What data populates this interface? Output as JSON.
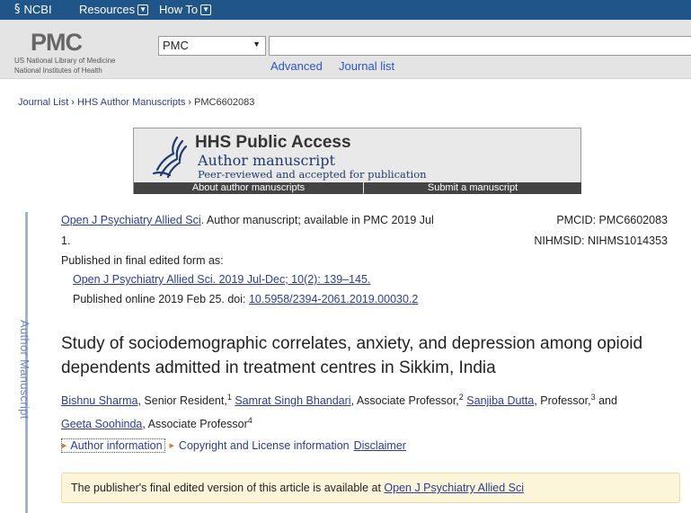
{
  "topbar": {
    "ncbi_label": "NCBI",
    "resources_label": "Resources",
    "howto_label": "How To"
  },
  "header": {
    "logo_text": "PMC",
    "logo_line1": "US National Library of Medicine",
    "logo_line2": "National Institutes of Health",
    "db_selected": "PMC",
    "search_value": "",
    "advanced_label": "Advanced",
    "journal_list_label": "Journal list"
  },
  "breadcrumb": {
    "items": [
      "Journal List",
      "HHS Author Manuscripts",
      "PMC6602083"
    ],
    "separator": "›"
  },
  "banner": {
    "title": "HHS Public Access",
    "subtitle": "Author manuscript",
    "tagline": "Peer-reviewed and accepted for publication",
    "about_label": "About author manuscripts",
    "submit_label": "Submit a manuscript"
  },
  "side_label": "Author Manuscript",
  "citation": {
    "journal_link": "Open J Psychiatry Allied Sci",
    "availability": ". Author manuscript; available in PMC 2019 Jul",
    "availability_cont": "1.",
    "published_label": "Published in final edited form as:",
    "final_ref": "Open J Psychiatry Allied Sci. 2019 Jul-Dec; 10(2): 139–145.",
    "online_prefix": "Published online 2019 Feb 25. doi: ",
    "doi": "10.5958/2394-2061.2019.00030.2",
    "pmcid": "PMCID: PMC6602083",
    "nihmsid": "NIHMSID: NIHMS1014353"
  },
  "article": {
    "title": "Study of sociodemographic correlates, anxiety, and depression among opioid dependents admitted in treatment centres in Sikkim, India",
    "authors": [
      {
        "name": "Bishnu Sharma",
        "role": ", Senior Resident,",
        "sup": "1"
      },
      {
        "name": "Samrat Singh Bhandari",
        "role": ", Associate Professor,",
        "sup": "2"
      },
      {
        "name": "Sanjiba Dutta",
        "role": ", Professor,",
        "sup": "3",
        "suffix": " and"
      },
      {
        "name": "Geeta Soohinda",
        "role": ", Associate Professor",
        "sup": "4"
      }
    ]
  },
  "info_links": {
    "author_info": "Author information",
    "copyright": "Copyright and License information",
    "disclaimer": "Disclaimer"
  },
  "notice": {
    "text": "The publisher's final edited version of this article is available at ",
    "link": "Open J Psychiatry Allied Sci"
  }
}
